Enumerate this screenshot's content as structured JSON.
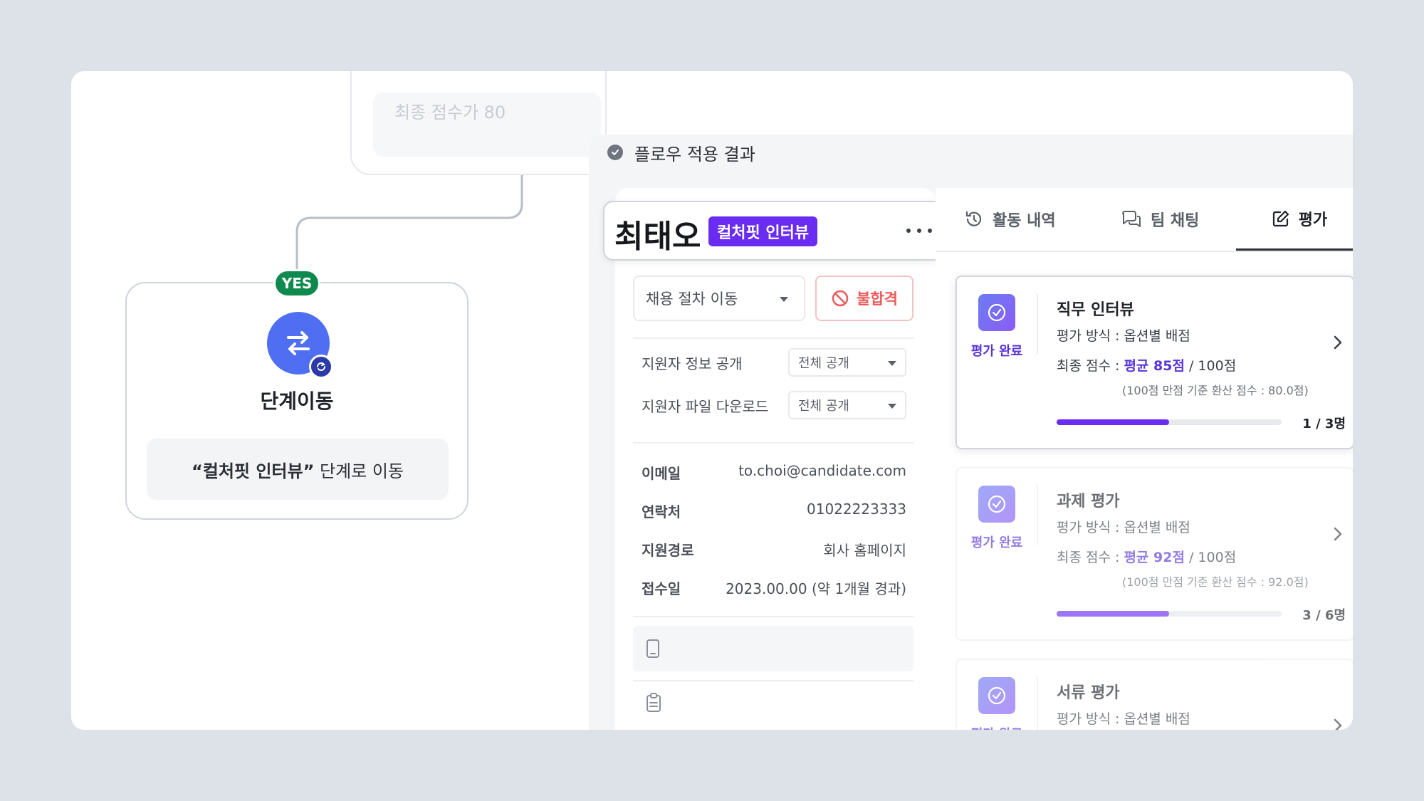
{
  "flow": {
    "ghost_condition": "최종 점수가 80",
    "yes_label": "YES",
    "step_title": "단계이동",
    "step_desc_quoted": "“컬처핏 인터뷰”",
    "step_desc_suffix": " 단계로 이동"
  },
  "result": {
    "header_title": "플로우 적용 결과",
    "candidate": {
      "name": "최태오",
      "stage": "컬처핏 인터뷰"
    },
    "actions": {
      "stage_select_placeholder": "채용 절차 이동",
      "reject_label": "불합격"
    },
    "options": [
      {
        "label": "지원자 정보 공개",
        "value": "전체 공개"
      },
      {
        "label": "지원자 파일 다운로드",
        "value": "전체 공개"
      }
    ],
    "info": [
      {
        "key": "이메일",
        "value": "to.choi@candidate.com"
      },
      {
        "key": "연락처",
        "value": "01022223333"
      },
      {
        "key": "지원경로",
        "value": "회사 홈페이지"
      },
      {
        "key": "접수일",
        "value": "2023.00.00 (약 1개월 경과)"
      }
    ],
    "tabs": [
      {
        "label": "활동 내역",
        "icon": "history-icon"
      },
      {
        "label": "팀 채팅",
        "icon": "chat-icon"
      },
      {
        "label": "평가",
        "icon": "edit-icon"
      }
    ],
    "evaluations": [
      {
        "badge": "평가 완료",
        "title": "직무 인터뷰",
        "method": "평가 방식 : 옵션별 배점",
        "score_prefix": "최종 점수 : ",
        "score_avg": "평균 85점",
        "score_total": " / 100점",
        "note": "(100점 만점 기준 환산 점수 : 80.0점)",
        "count": "1 / 3명",
        "progress": 0.5
      },
      {
        "badge": "평가 완료",
        "title": "과제 평가",
        "method": "평가 방식 : 옵션별 배점",
        "score_prefix": "최종 점수 : ",
        "score_avg": "평균 92점",
        "score_total": " / 100점",
        "note": "(100점 만점 기준 환산 점수 : 92.0점)",
        "count": "3 / 6명",
        "progress": 0.5
      },
      {
        "badge": "평가 완료",
        "title": "서류 평가",
        "method": "평가 방식 : 옵션별 배점"
      }
    ]
  },
  "colors": {
    "accent": "#6a2cf0",
    "yes": "#0e8a4e",
    "reject": "#ec5a5a",
    "step": "#4f6ef2"
  }
}
